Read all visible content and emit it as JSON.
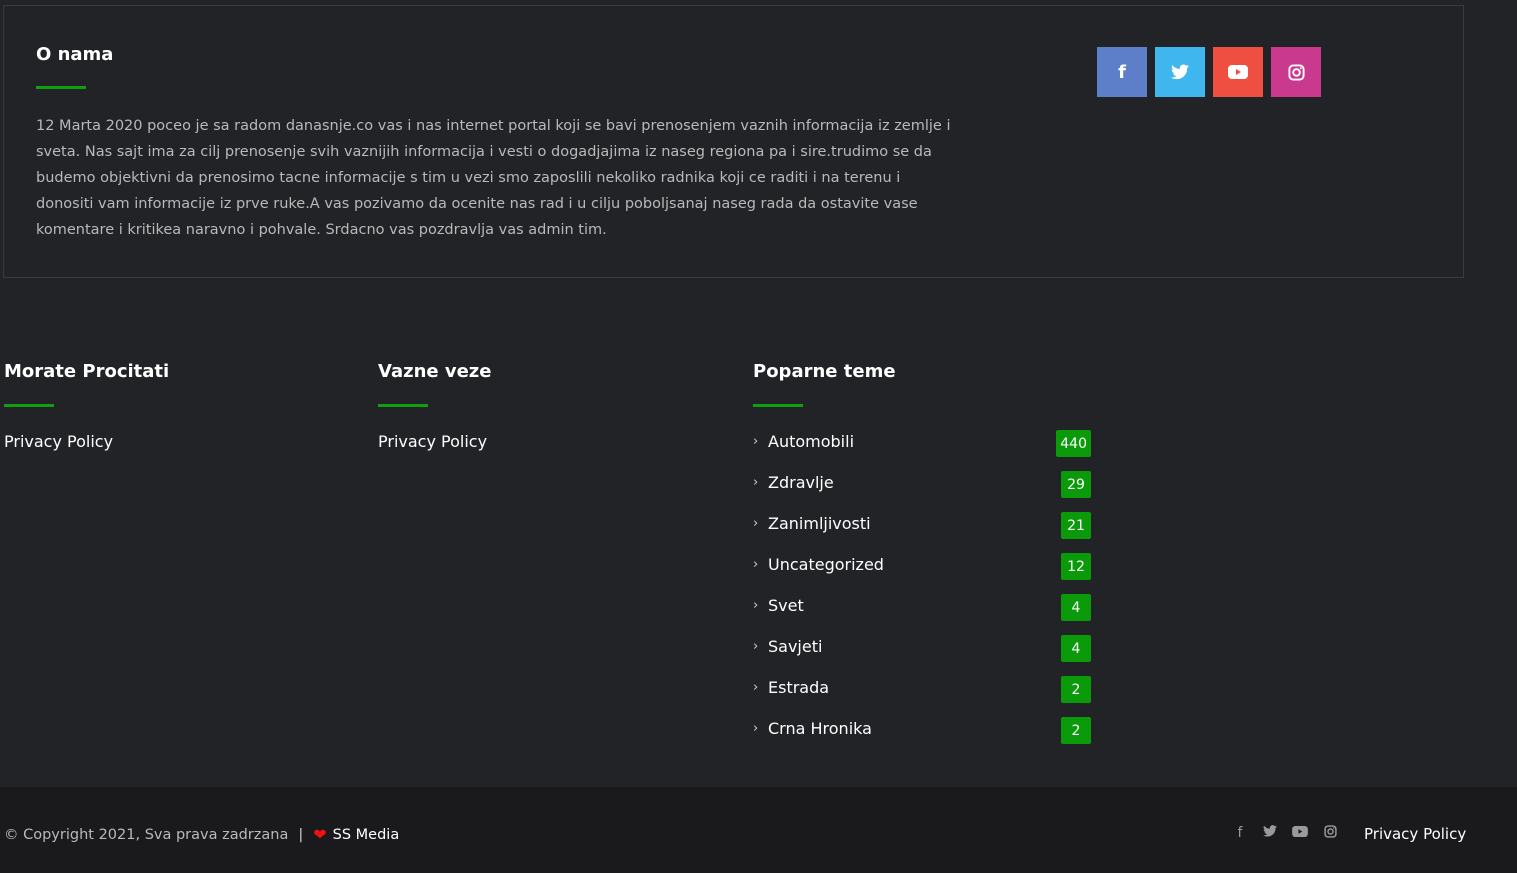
{
  "about": {
    "title": "O nama",
    "text": "12 Marta 2020 poceo je sa radom danasnje.co vas i nas internet portal koji se bavi prenosenjem vaznih informacija iz zemlje i sveta. Nas sajt ima za cilj prenosenje svih vaznijih informacija i vesti o dogadjajima iz naseg regiona pa i sire.trudimo se da budemo objektivni da prenosimo tacne informacije s tim u vezi smo zaposlili nekoliko radnika koji ce raditi i na terenu i donositi vam informacije iz prve ruke.A vas pozivamo da ocenite nas rad i u cilju poboljsanaj naseg rada da ostavite vase komentare i kritikea naravno i pohvale. Srdacno vas pozdravlja vas admin tim."
  },
  "social": {
    "facebook": {
      "icon": "facebook-icon",
      "color": "#5d7fc9"
    },
    "twitter": {
      "icon": "twitter-icon",
      "color": "#3fb6ee"
    },
    "youtube": {
      "icon": "youtube-icon",
      "color": "#ef4f40"
    },
    "instagram": {
      "icon": "instagram-icon",
      "color": "#c93a8e"
    }
  },
  "columns": {
    "must_read": {
      "title": "Morate Procitati",
      "link": "Privacy Policy"
    },
    "important": {
      "title": "Vazne veze",
      "link": "Privacy Policy"
    },
    "popular": {
      "title": "Poparne teme"
    }
  },
  "categories": [
    {
      "name": "Automobili",
      "count": "440"
    },
    {
      "name": "Zdravlje",
      "count": "29"
    },
    {
      "name": "Zanimljivosti",
      "count": "21"
    },
    {
      "name": "Uncategorized",
      "count": "12"
    },
    {
      "name": "Svet",
      "count": "4"
    },
    {
      "name": "Savjeti",
      "count": "4"
    },
    {
      "name": "Estrada",
      "count": "2"
    },
    {
      "name": "Crna Hronika",
      "count": "2"
    }
  ],
  "footer": {
    "copyright": "© Copyright 2021, Sva prava zadrzana",
    "separator": "|",
    "brand": "SS Media",
    "privacy": "Privacy Policy"
  },
  "colors": {
    "accent": "#0fa00f",
    "badge": "#0a9a0a",
    "background": "#222326",
    "footer": "#1a1a1c"
  }
}
